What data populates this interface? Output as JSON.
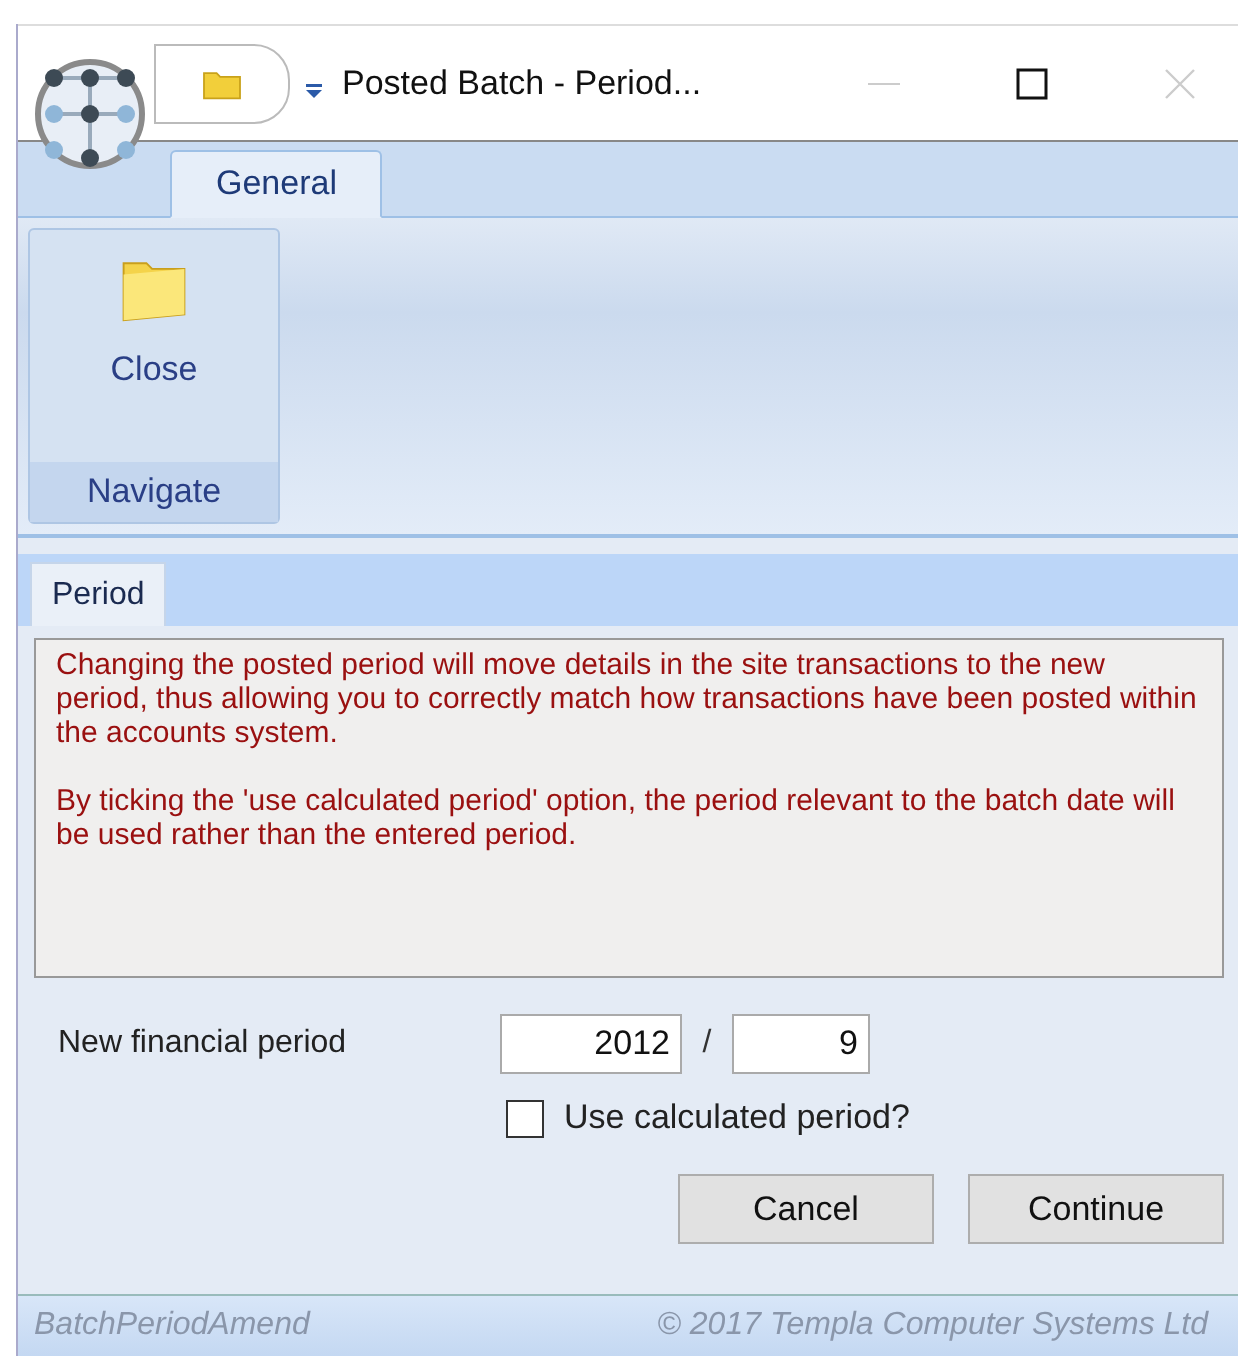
{
  "window": {
    "title": "Posted Batch - Period..."
  },
  "ribbon": {
    "tabs": [
      {
        "label": "General",
        "selected": true
      }
    ],
    "groups": [
      {
        "label": "Navigate",
        "buttons": [
          {
            "label": "Close"
          }
        ]
      }
    ]
  },
  "page_tabs": [
    {
      "label": "Period",
      "selected": true
    }
  ],
  "info": [
    "Changing the posted period will move details in the site transactions to the new period, thus allowing you to correctly match how transactions have been posted within the accounts system.",
    "By ticking the 'use calculated period' option, the period relevant to the batch date will be used rather than the entered period."
  ],
  "form": {
    "label": "New financial period",
    "year": "2012",
    "separator": "/",
    "period": "9",
    "checkbox": {
      "label": "Use calculated period?",
      "checked": false
    }
  },
  "buttons": [
    "Cancel",
    "Continue"
  ],
  "status_bar": {
    "left": "BatchPeriodAmend",
    "right": "© 2017 Templa Computer Systems Ltd"
  }
}
